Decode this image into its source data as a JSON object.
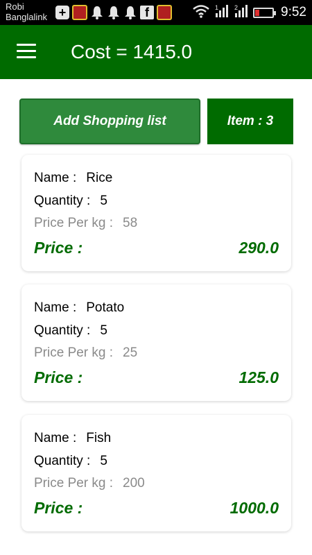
{
  "status_bar": {
    "carrier_line1": "Robi",
    "carrier_line2": "Banglalink",
    "time": "9:52",
    "signal1_label": "1",
    "signal2_label": "2"
  },
  "app_bar": {
    "title": "Cost = 1415.0"
  },
  "actions": {
    "add_label": "Add Shopping list",
    "item_count": "Item : 3"
  },
  "labels": {
    "name": "Name :",
    "quantity": "Quantity :",
    "price_per_kg": "Price Per kg :",
    "price": "Price :"
  },
  "items": [
    {
      "name": "Rice",
      "quantity": "5",
      "price_per_kg": "58",
      "price": "290.0"
    },
    {
      "name": "Potato",
      "quantity": "5",
      "price_per_kg": "25",
      "price": "125.0"
    },
    {
      "name": "Fish",
      "quantity": "5",
      "price_per_kg": "200",
      "price": "1000.0"
    }
  ],
  "colors": {
    "primary": "#006b00",
    "button": "#2f8a3c",
    "muted_text": "#8a8a8a"
  }
}
